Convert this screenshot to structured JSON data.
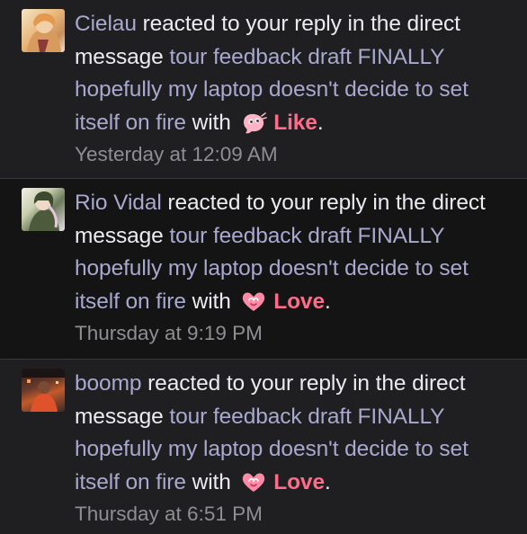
{
  "notifications": [
    {
      "user": "Cielau",
      "action": " reacted to your reply in the direct message ",
      "thread": "tour feedback draft FINALLY hopefully my laptop doesn't decide to set itself on fire",
      "with": " with ",
      "reaction": "Like",
      "reaction_icon": "like-icon",
      "period": ".",
      "time": "Yesterday at 12:09 AM"
    },
    {
      "user": "Rio Vidal",
      "action": " reacted to your reply in the direct message ",
      "thread": "tour feedback draft FINALLY hopefully my laptop doesn't decide to set itself on fire",
      "with": " with ",
      "reaction": "Love",
      "reaction_icon": "love-icon",
      "period": ".",
      "time": "Thursday at 9:19 PM"
    },
    {
      "user": "boomp",
      "action": " reacted to your reply in the direct message ",
      "thread": "tour feedback draft FINALLY hopefully my laptop doesn't decide to set itself on fire",
      "with": " with ",
      "reaction": "Love",
      "reaction_icon": "love-icon",
      "period": ".",
      "time": "Thursday at 6:51 PM"
    }
  ],
  "colors": {
    "link": "#a9a8cf",
    "reaction": "#ff6b8a",
    "timestamp": "#8e8e93",
    "text": "#ebebf0"
  }
}
